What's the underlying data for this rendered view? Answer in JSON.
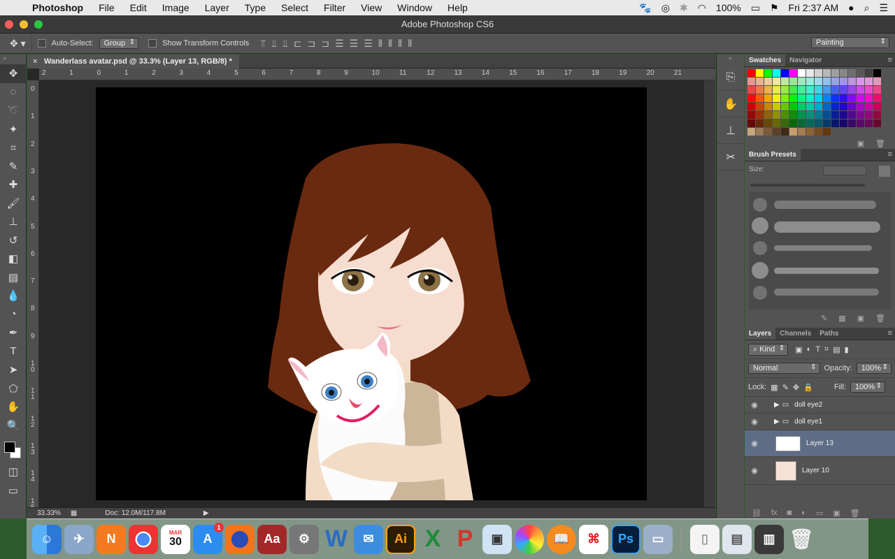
{
  "menubar": {
    "items": [
      "Photoshop",
      "File",
      "Edit",
      "Image",
      "Layer",
      "Type",
      "Select",
      "Filter",
      "View",
      "Window",
      "Help"
    ],
    "battery": "100%",
    "clock": "Fri 2:37 AM"
  },
  "window": {
    "title": "Adobe Photoshop CS6"
  },
  "options": {
    "auto_select_label": "Auto-Select:",
    "auto_select_value": "Group",
    "transform_label": "Show Transform Controls",
    "workspace": "Painting"
  },
  "document": {
    "tab_title": "Wanderlass avatar.psd @ 33.3% (Layer 13, RGB/8) *",
    "zoom": "33.33%",
    "doc_size": "Doc: 12.0M/117.8M",
    "ruler_h": [
      "2",
      "1",
      "0",
      "1",
      "2",
      "3",
      "4",
      "5",
      "6",
      "7",
      "8",
      "9",
      "10",
      "11",
      "12",
      "13",
      "14",
      "15",
      "16",
      "17",
      "18",
      "19",
      "20",
      "21"
    ],
    "ruler_v": [
      "0",
      "1",
      "2",
      "3",
      "4",
      "5",
      "6",
      "7",
      "8",
      "9",
      "1\n0",
      "1\n1",
      "1\n2",
      "1\n3",
      "1\n4",
      "1\n5"
    ]
  },
  "swatches_panel": {
    "tabs": [
      "Swatches",
      "Navigator"
    ]
  },
  "brush_panel": {
    "title": "Brush Presets",
    "size_label": "Size:"
  },
  "layers_panel": {
    "tabs": [
      "Layers",
      "Channels",
      "Paths"
    ],
    "kind": "Kind",
    "blend_mode": "Normal",
    "opacity_label": "Opacity:",
    "opacity": "100%",
    "lock_label": "Lock:",
    "fill_label": "Fill:",
    "fill": "100%",
    "layers": [
      {
        "name": "doll eye2",
        "type": "group"
      },
      {
        "name": "doll eye1",
        "type": "group"
      },
      {
        "name": "Layer 13",
        "type": "layer",
        "selected": true
      },
      {
        "name": "Layer 10",
        "type": "layer"
      }
    ]
  },
  "dock": {
    "icons": [
      "finder-icon",
      "preview-icon",
      "n-app-icon",
      "chrome-icon",
      "calendar-icon",
      "app-store-icon",
      "firefox-icon",
      "dictionary-icon",
      "system-prefs-icon",
      "word-icon",
      "mail-icon",
      "illustrator-icon",
      "excel-icon",
      "powerpoint-icon",
      "preview2-icon",
      "photos-icon",
      "ibooks-icon",
      "acrobat-icon",
      "photoshop-icon",
      "image-capture-icon",
      "document-icon",
      "screenshot-icon",
      "desktop-icon",
      "trash-icon"
    ],
    "calendar_month": "MAR",
    "calendar_day": "30",
    "appstore_badge": "1",
    "illustrator_label": "Ai",
    "photoshop_label": "Ps"
  }
}
